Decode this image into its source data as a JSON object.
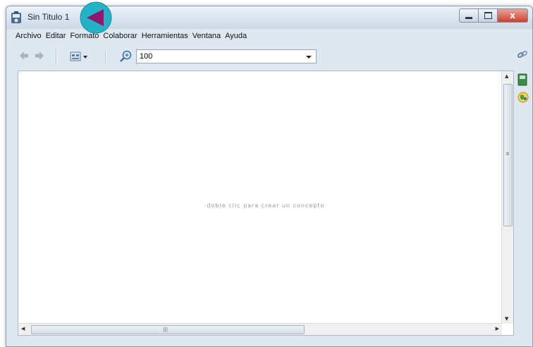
{
  "window": {
    "title": "Sin Titulo 1",
    "close_glyph": "x"
  },
  "menu": {
    "items": [
      "Archivo",
      "Editar",
      "Formato",
      "Colaborar",
      "Herramientas",
      "Ventana",
      "Ayuda"
    ]
  },
  "toolbar": {
    "zoom": {
      "value": "100"
    },
    "icons": [
      "back-arrow-icon",
      "forward-arrow-icon",
      "view-options-icon",
      "zoom-icon"
    ]
  },
  "canvas": {
    "hint": "doble clic para crear un concepto"
  },
  "side_panel": {
    "icons": [
      "link-icon",
      "book-icon",
      "globe-icon"
    ]
  },
  "colors": {
    "overlay_circle": "#24b2c6",
    "overlay_triangle": "#8a1a6e",
    "close_button": "#c8422e"
  }
}
